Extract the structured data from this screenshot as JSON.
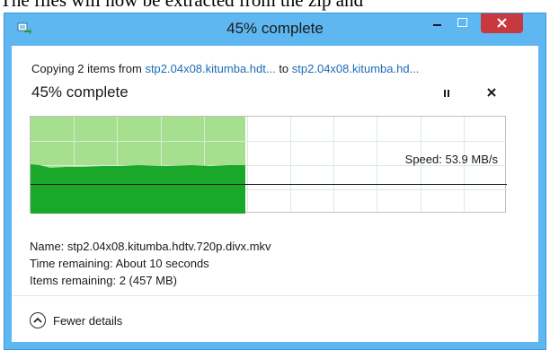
{
  "background_text": "The files will now be extracted from the zip and",
  "window": {
    "title": "45% complete",
    "controls": {
      "minimize_icon": "minimize-icon",
      "maximize_icon": "maximize-icon",
      "close_icon": "close-icon"
    }
  },
  "copy": {
    "prefix": "Copying 2 items from ",
    "from": "stp2.04x08.kitumba.hdt...",
    "middle": " to ",
    "to": "stp2.04x08.kitumba.hd..."
  },
  "progress": {
    "percent_text": "45% complete",
    "percent": 45,
    "speed_text": "Speed: 53.9 MB/s"
  },
  "details": {
    "name": "Name:  stp2.04x08.kitumba.hdtv.720p.divx.mkv",
    "time_remaining": "Time remaining:  About 10 seconds",
    "items_remaining": "Items remaining:  2 (457 MB)"
  },
  "footer": {
    "toggle_label": "Fewer details"
  },
  "colors": {
    "title_bar": "#5eb7f0",
    "graph_done": "#a6e08f",
    "graph_fill": "#1aa82a",
    "close_button": "#c7383f",
    "link": "#1c6bb5"
  }
}
